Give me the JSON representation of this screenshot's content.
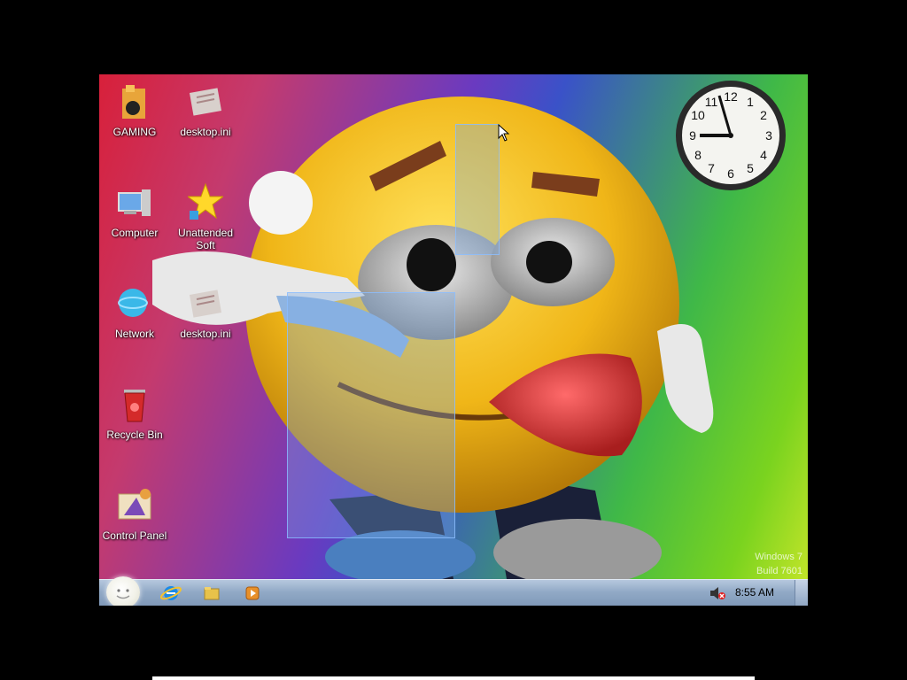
{
  "desktop": {
    "icons": [
      {
        "label": "GAMING",
        "icon": "gaming-folder-icon"
      },
      {
        "label": "desktop.ini",
        "icon": "ini-file-icon"
      },
      {
        "label": "Computer",
        "icon": "computer-icon"
      },
      {
        "label": "Unattended",
        "label2": "Soft",
        "icon": "star-shortcut-icon"
      },
      {
        "label": "Network",
        "icon": "network-icon"
      },
      {
        "label": "desktop.ini",
        "icon": "ini-file-icon"
      },
      {
        "label": "Recycle Bin",
        "icon": "recycle-bin-icon"
      },
      {
        "label": "Control Panel",
        "icon": "control-panel-icon"
      }
    ],
    "watermark": {
      "line1": "Windows 7",
      "line2": "Build 7601"
    }
  },
  "clock_gadget": {
    "numbers": [
      "12",
      "1",
      "2",
      "3",
      "4",
      "5",
      "6",
      "7",
      "8",
      "9",
      "10",
      "11"
    ],
    "time": "8:55"
  },
  "taskbar": {
    "pinned": [
      {
        "name": "internet-explorer",
        "icon": "ie-icon"
      },
      {
        "name": "explorer",
        "icon": "folder-icon"
      },
      {
        "name": "media-player",
        "icon": "media-player-icon"
      }
    ],
    "tray": {
      "volume_icon": "volume-muted-icon",
      "time": "8:55 AM"
    }
  },
  "colors": {
    "taskbar": "#91a9c6",
    "selection": "#78aae6"
  }
}
